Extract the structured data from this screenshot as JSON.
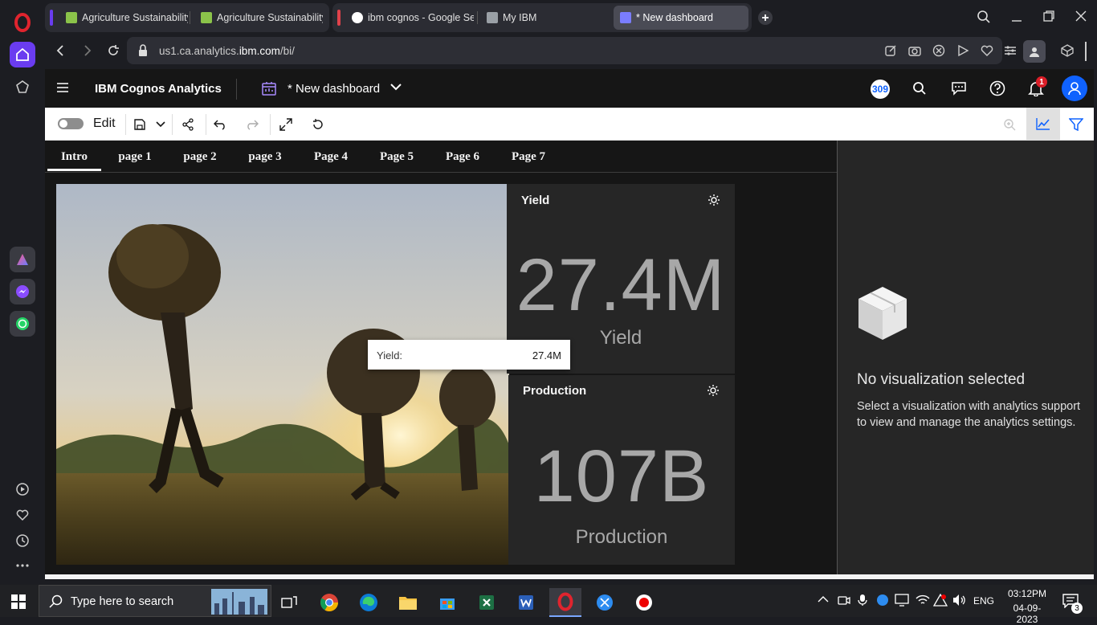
{
  "browser": {
    "tabs": [
      {
        "label": "Agriculture Sustainability",
        "group_color": "#6a3cf0"
      },
      {
        "label": "Agriculture Sustainability",
        "group_color": "#6a3cf0"
      },
      {
        "label": "ibm cognos - Google Sea",
        "group_color": "#e0424b"
      },
      {
        "label": "My IBM"
      },
      {
        "label": "* New dashboard",
        "active": true
      }
    ],
    "url_prefix": "us1.ca.analytics.",
    "url_domain": "ibm.com",
    "url_suffix": "/bi/"
  },
  "cognos": {
    "brand": "IBM Cognos Analytics",
    "dashboard_title": "* New dashboard",
    "badge_count": "309",
    "notification_count": "1",
    "edit_label": "Edit"
  },
  "pages": [
    "Intro",
    "page 1",
    "page 2",
    "page 3",
    "Page 4",
    "Page 5",
    "Page 6",
    "Page 7"
  ],
  "active_page": "Intro",
  "widgets": {
    "yield": {
      "title": "Yield",
      "value": "27.4M",
      "label": "Yield"
    },
    "production": {
      "title": "Production",
      "value": "107B",
      "label": "Production"
    },
    "tooltip": {
      "label": "Yield:",
      "value": "27.4M"
    }
  },
  "analytics_panel": {
    "heading": "No visualization selected",
    "body": "Select a visualization with analytics support to view and manage the analytics settings."
  },
  "taskbar": {
    "search_placeholder": "Type here to search",
    "language": "ENG",
    "time": "03:12PM",
    "date": "04-09-2023",
    "notifications": "3"
  },
  "colors": {
    "opera_red": "#e0242e",
    "ibm_blue": "#0f62fe",
    "accent_purple": "#6a3cf0",
    "kpi_value": "#a8a8a8"
  }
}
